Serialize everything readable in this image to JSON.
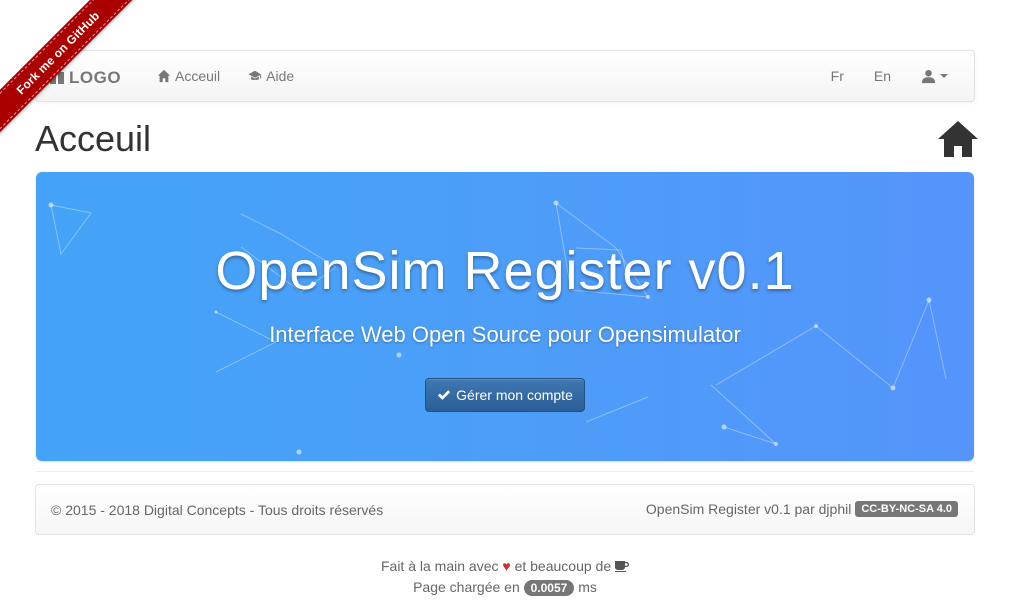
{
  "ribbon": {
    "label": "Fork me on GitHub"
  },
  "navbar": {
    "brand": "LOGO",
    "links": [
      {
        "label": "Acceuil",
        "icon": "home-icon"
      },
      {
        "label": "Aide",
        "icon": "graduation-cap-icon"
      }
    ],
    "languages": [
      "Fr",
      "En"
    ],
    "user_icon": "user-icon"
  },
  "page": {
    "title": "Acceuil",
    "title_icon": "home-icon"
  },
  "jumbotron": {
    "title": "OpenSim Register v0.1",
    "subtitle": "Interface Web Open Source pour Opensimulator",
    "button_label": "Gérer mon compte",
    "button_icon": "check-icon"
  },
  "footer": {
    "copyright": "© 2015 - 2018 Digital Concepts - Tous droits réservés",
    "credit": "OpenSim Register v0.1 par djphil",
    "license": "CC-BY-NC-SA 4.0"
  },
  "credits": {
    "made_prefix": "Fait à la main avec",
    "heart": "♥",
    "made_middle": "et beaucoup de",
    "coffee_icon": "coffee-icon",
    "load_prefix": "Page chargée en",
    "load_time": "0.0057",
    "load_unit": "ms"
  },
  "colors": {
    "jumbotron_start": "#44a3f7",
    "jumbotron_end": "#5594fb",
    "button": "#2f6aa5",
    "ribbon": "#aa0000",
    "heart": "#c9302c"
  }
}
